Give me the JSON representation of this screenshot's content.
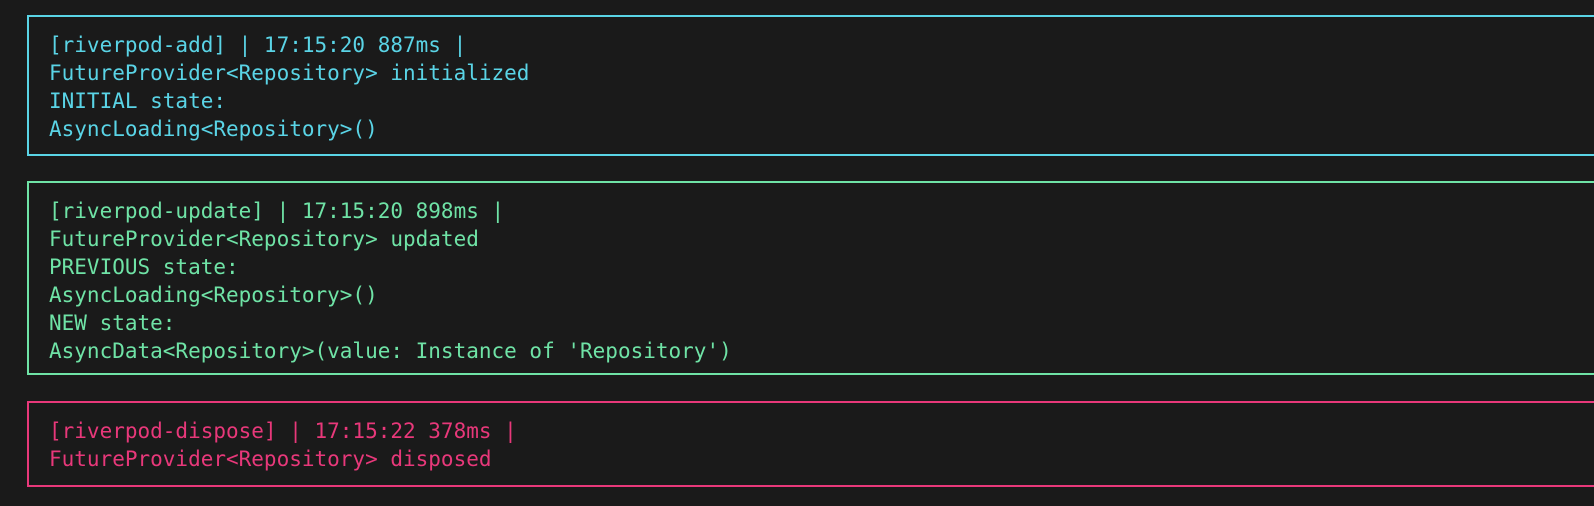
{
  "colors": {
    "background": "#1a1a1a",
    "add": "#5ad4e6",
    "update": "#6fe3a6",
    "dispose": "#e8387a"
  },
  "logs": {
    "add": {
      "header": "[riverpod-add] | 17:15:20 887ms |",
      "line1": "FutureProvider<Repository> initialized",
      "line2": "INITIAL state:",
      "line3": "AsyncLoading<Repository>()"
    },
    "update": {
      "header": "[riverpod-update] | 17:15:20 898ms |",
      "line1": "FutureProvider<Repository> updated",
      "line2": "PREVIOUS state:",
      "line3": "AsyncLoading<Repository>()",
      "line4": "NEW state:",
      "line5": "AsyncData<Repository>(value: Instance of 'Repository')"
    },
    "dispose": {
      "header": "[riverpod-dispose] | 17:15:22 378ms |",
      "line1": "FutureProvider<Repository> disposed"
    }
  }
}
